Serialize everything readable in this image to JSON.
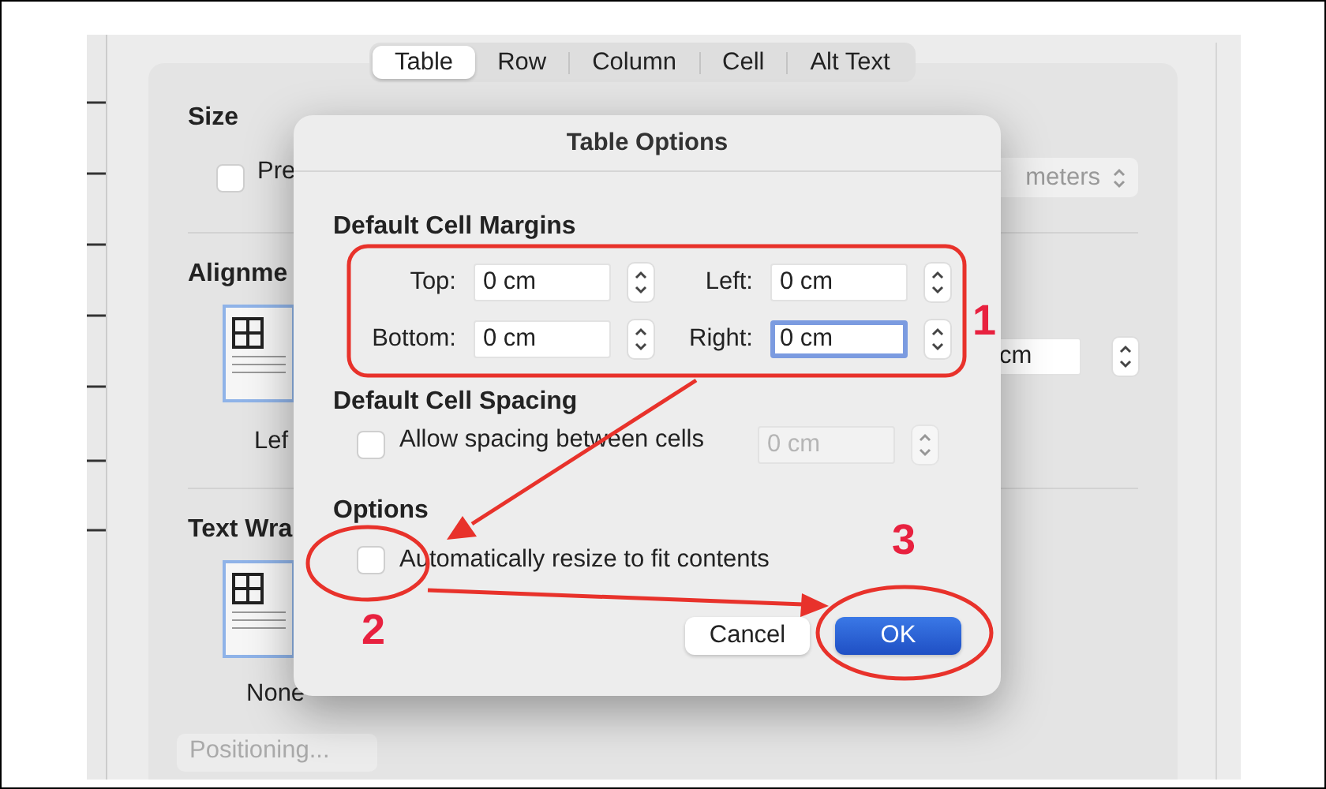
{
  "tabs": [
    {
      "label": "Table",
      "selected": true
    },
    {
      "label": "Row",
      "selected": false
    },
    {
      "label": "Column",
      "selected": false
    },
    {
      "label": "Cell",
      "selected": false
    },
    {
      "label": "Alt Text",
      "selected": false
    }
  ],
  "background": {
    "size_heading": "Size",
    "preferred": {
      "label": "Pre",
      "checked": false
    },
    "units_popup": "meters",
    "alignment_heading": "Alignme",
    "alignment_option": "Lef",
    "width_field": "cm",
    "text_wrap_heading": "Text Wra",
    "wrap_options": [
      "None"
    ],
    "positioning_button": "Positioning..."
  },
  "dialog": {
    "title": "Table Options",
    "margins_heading": "Default Cell Margins",
    "margins": [
      {
        "label": "Top:",
        "value": "0 cm",
        "focused": false
      },
      {
        "label": "Left:",
        "value": "0 cm",
        "focused": false
      },
      {
        "label": "Bottom:",
        "value": "0 cm",
        "focused": false
      },
      {
        "label": "Right:",
        "value": "0 cm",
        "focused": true
      }
    ],
    "spacing_heading": "Default Cell Spacing",
    "spacing": {
      "label": "Allow spacing between cells",
      "checked": false,
      "value": "0 cm",
      "disabled": true
    },
    "options_heading": "Options",
    "autoresize": {
      "label": "Automatically resize to fit contents",
      "checked": false
    },
    "buttons": [
      {
        "label": "Cancel",
        "default": false
      },
      {
        "label": "OK",
        "default": true
      }
    ]
  },
  "annotations": [
    {
      "label": "1"
    },
    {
      "label": "2"
    },
    {
      "label": "3"
    }
  ]
}
